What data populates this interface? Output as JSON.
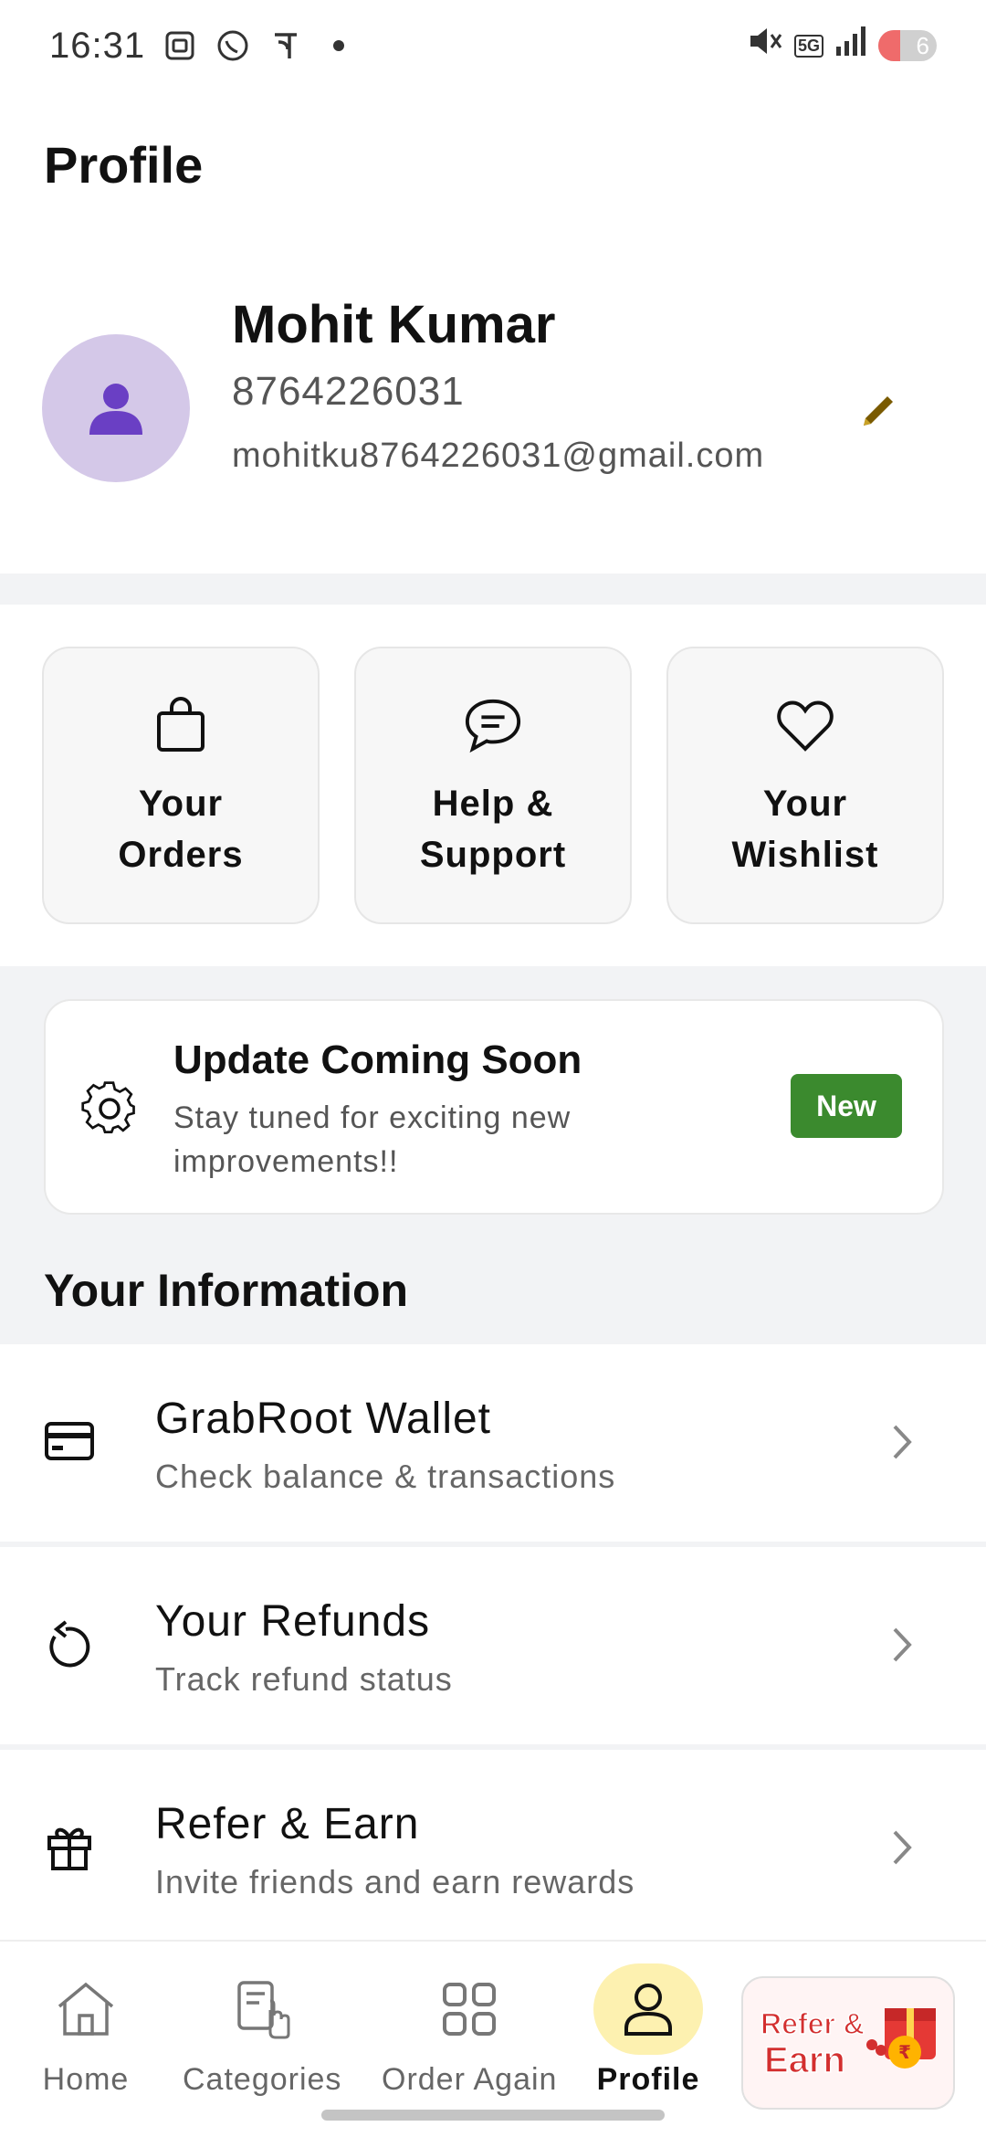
{
  "status_bar": {
    "time": "16:31",
    "network": "5G",
    "battery": "6",
    "icons": [
      "screenshot-icon",
      "whatsapp-icon",
      "phonepe-icon",
      "dot-icon",
      "mute-icon",
      "signal-icon",
      "battery-icon"
    ]
  },
  "page": {
    "title": "Profile"
  },
  "profile": {
    "name": "Mohit Kumar",
    "phone": "8764226031",
    "email": "mohitku8764226031@gmail.com",
    "avatar_color": "#d4c8e8",
    "avatar_icon_color": "#6a3fc4"
  },
  "quick_actions": [
    {
      "label": "Your Orders",
      "icon": "shopping-bag-icon"
    },
    {
      "label": "Help & Support",
      "icon": "chat-bubble-icon"
    },
    {
      "label": "Your Wishlist",
      "icon": "heart-icon"
    }
  ],
  "update_card": {
    "title": "Update Coming Soon",
    "subtitle": "Stay tuned for exciting new improvements!!",
    "badge": "New",
    "badge_color": "#3b8a2e"
  },
  "section": {
    "title": "Your Information"
  },
  "info_items": [
    {
      "title": "GrabRoot Wallet",
      "subtitle": "Check balance & transactions",
      "icon": "wallet-card-icon"
    },
    {
      "title": "Your Refunds",
      "subtitle": "Track refund status",
      "icon": "refund-icon"
    },
    {
      "title": "Refer & Earn",
      "subtitle": "Invite friends and earn rewards",
      "icon": "gift-icon"
    }
  ],
  "bottom_nav": {
    "items": [
      {
        "label": "Home",
        "icon": "home-icon"
      },
      {
        "label": "Categories",
        "icon": "categories-icon"
      },
      {
        "label": "Order Again",
        "icon": "grid-icon"
      },
      {
        "label": "Profile",
        "icon": "user-icon",
        "active": true
      }
    ],
    "promo": {
      "line1": "Refer &",
      "line2": "Earn"
    },
    "active_color": "#fdf1b0"
  }
}
